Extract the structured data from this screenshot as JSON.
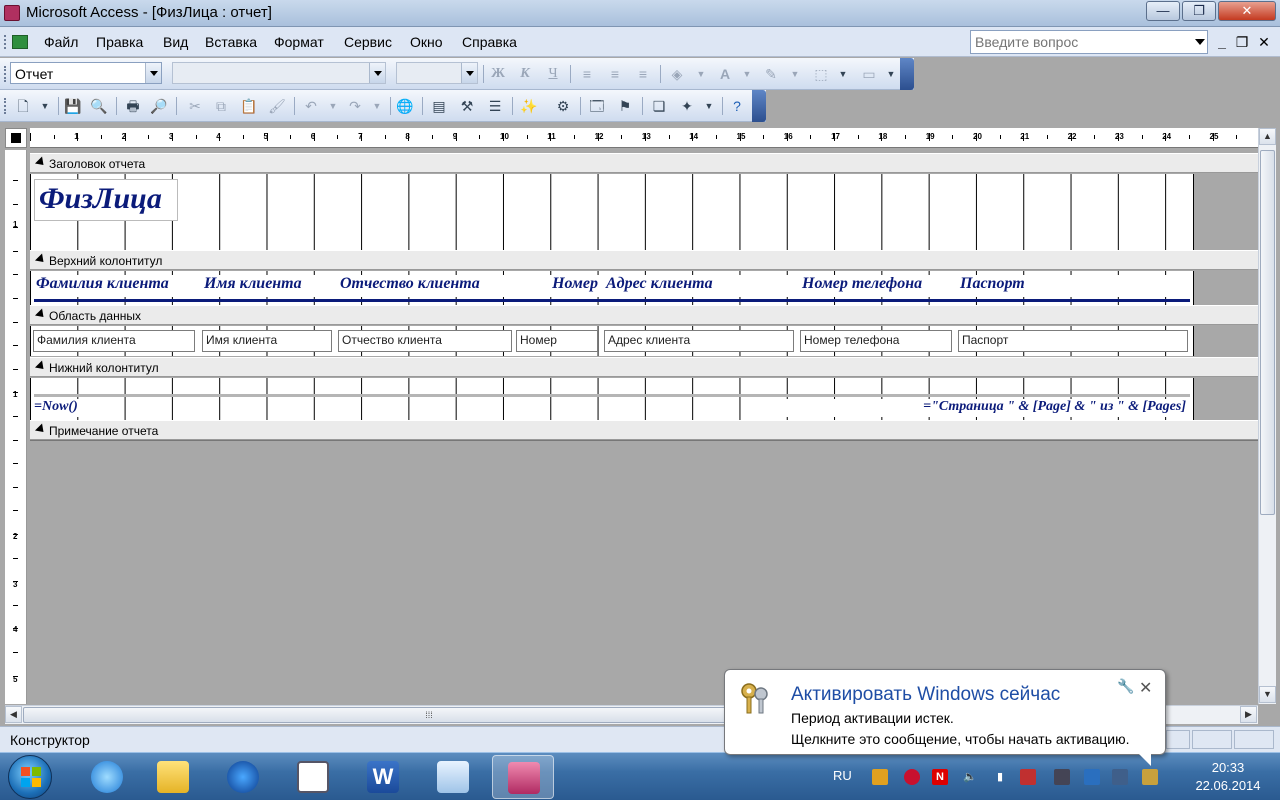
{
  "window": {
    "title": "Microsoft Access - [ФизЛица : отчет]",
    "minimize_glyph": "—",
    "restore_glyph": "❐",
    "close_glyph": "✕"
  },
  "menu": {
    "items": [
      "Файл",
      "Правка",
      "Вид",
      "Вставка",
      "Формат",
      "Сервис",
      "Окно",
      "Справка"
    ],
    "help_placeholder": "Введите вопрос",
    "mdi_minimize": "_",
    "mdi_restore": "❐",
    "mdi_close": "✕"
  },
  "formatting_toolbar": {
    "object_combo": "Отчет",
    "font_combo": "",
    "size_combo": "",
    "bold": "Ж",
    "italic": "К",
    "underline": "Ч",
    "font_color": "A"
  },
  "design": {
    "ruler_numbers": [
      "1",
      "2",
      "3",
      "4",
      "5",
      "6",
      "7",
      "8",
      "9",
      "10",
      "11",
      "12",
      "13",
      "14",
      "15",
      "16",
      "17",
      "18",
      "19",
      "20",
      "21",
      "22",
      "23",
      "24",
      "25"
    ],
    "vruler_numbers": [
      "1",
      "1",
      "2",
      "3",
      "4",
      "5"
    ],
    "sections": {
      "report_header": "Заголовок отчета",
      "page_header": "Верхний колонтитул",
      "detail": "Область данных",
      "page_footer": "Нижний колонтитул",
      "report_footer": "Примечание отчета"
    },
    "report_title": "ФизЛица",
    "header_labels": [
      "Фамилия клиента",
      "Имя клиента",
      "Отчество клиента",
      "Номер",
      "Адрес клиента",
      "Номер телефона",
      "Паспорт"
    ],
    "detail_fields": [
      "Фамилия клиента",
      "Имя клиента",
      "Отчество клиента",
      "Номер",
      "Адрес клиента",
      "Номер телефона",
      "Паспорт"
    ],
    "footer_now": "=Now()",
    "footer_pages": "=\"Страница \" & [Page] & \" из \" & [Pages]"
  },
  "statusbar": {
    "mode": "Конструктор"
  },
  "taskbar": {
    "language": "RU",
    "time": "20:33",
    "date": "22.06.2014",
    "apps": [
      "internet-explorer",
      "windows-explorer",
      "media-player",
      "calendar",
      "microsoft-word",
      "notepad",
      "microsoft-access"
    ],
    "active_app": "microsoft-access"
  },
  "notification": {
    "title": "Активировать Windows сейчас",
    "line1": "Период активации истек.",
    "line2": "Щелкните это сообщение, чтобы начать активацию."
  },
  "colors": {
    "label_text": "#0b1b7a",
    "title_bar": "#b9cde6",
    "taskbar": "#3a6ea5",
    "notification_title": "#1e4da5"
  }
}
